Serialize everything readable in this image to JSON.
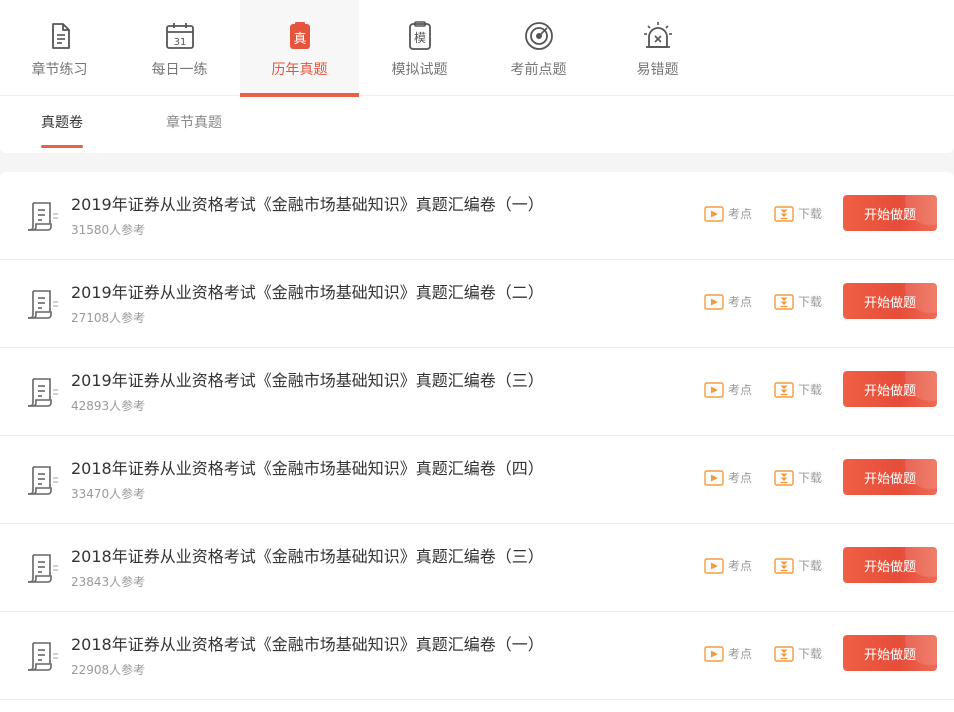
{
  "main_tabs": [
    {
      "label": "章节练习",
      "icon": "chapter-doc-icon",
      "active": false
    },
    {
      "label": "每日一练",
      "icon": "calendar-icon",
      "active": false,
      "icon_text": "31"
    },
    {
      "label": "历年真题",
      "icon": "real-exam-icon",
      "active": true,
      "icon_text": "真"
    },
    {
      "label": "模拟试题",
      "icon": "mock-exam-icon",
      "active": false,
      "icon_text": "模"
    },
    {
      "label": "考前点题",
      "icon": "target-icon",
      "active": false
    },
    {
      "label": "易错题",
      "icon": "alarm-icon",
      "active": false
    }
  ],
  "sub_tabs": [
    {
      "label": "真题卷",
      "active": true
    },
    {
      "label": "章节真题",
      "active": false
    }
  ],
  "papers": [
    {
      "title": "2019年证券从业资格考试《金融市场基础知识》真题汇编卷（一）",
      "count": "31580人参考"
    },
    {
      "title": "2019年证券从业资格考试《金融市场基础知识》真题汇编卷（二）",
      "count": "27108人参考"
    },
    {
      "title": "2019年证券从业资格考试《金融市场基础知识》真题汇编卷（三）",
      "count": "42893人参考"
    },
    {
      "title": "2018年证券从业资格考试《金融市场基础知识》真题汇编卷（四）",
      "count": "33470人参考"
    },
    {
      "title": "2018年证券从业资格考试《金融市场基础知识》真题汇编卷（三）",
      "count": "23843人参考"
    },
    {
      "title": "2018年证券从业资格考试《金融市场基础知识》真题汇编卷（一）",
      "count": "22908人参考"
    }
  ],
  "actions": {
    "kaodian_label": "考点",
    "download_label": "下载",
    "start_label": "开始做题"
  },
  "colors": {
    "accent": "#e8604c",
    "action_orange": "#f59a3c",
    "icon_gray": "#555555"
  }
}
